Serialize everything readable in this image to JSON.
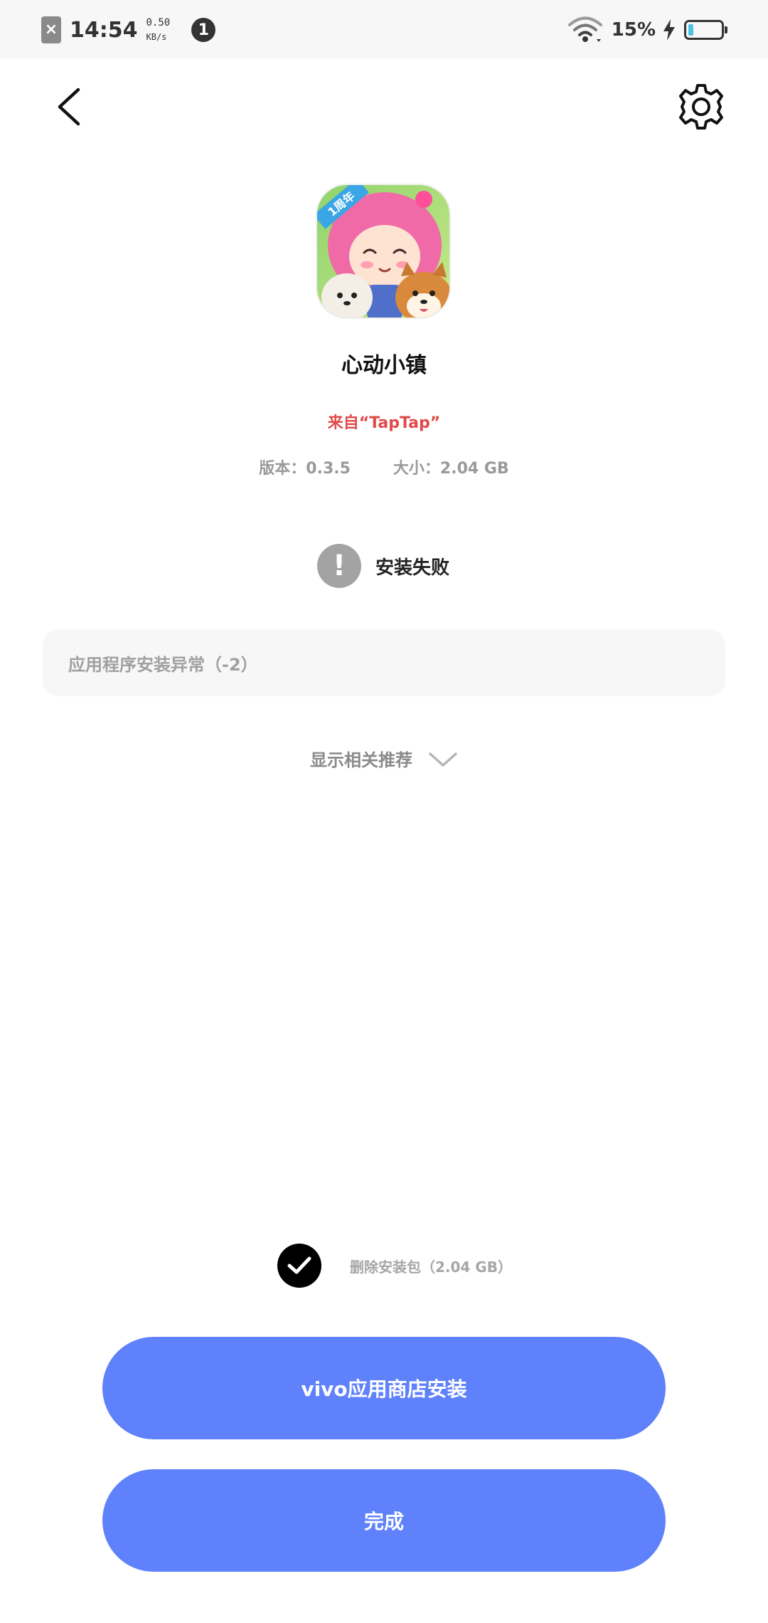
{
  "status_bar": {
    "time": "14:54",
    "net_speed_value": "0.50",
    "net_speed_unit": "KB/s",
    "notification_count": "1",
    "battery_percent": "15%",
    "battery_level": 0.15
  },
  "app": {
    "name": "心动小镇",
    "source": "来自“TapTap”",
    "version": "版本：0.3.5",
    "size": "大小：2.04 GB",
    "icon_badge": "1周年"
  },
  "install": {
    "status": "安装失败",
    "error_message": "应用程序安装异常（-2）",
    "show_recommend": "显示相关推荐",
    "delete_package_label": "删除安装包（2.04 GB）",
    "delete_package_checked": true
  },
  "buttons": {
    "store_install": "vivo应用商店安装",
    "done": "完成"
  },
  "colors": {
    "accent": "#5f81fb",
    "source_red": "#e04a4a",
    "status_gray": "#a3a3a3"
  }
}
